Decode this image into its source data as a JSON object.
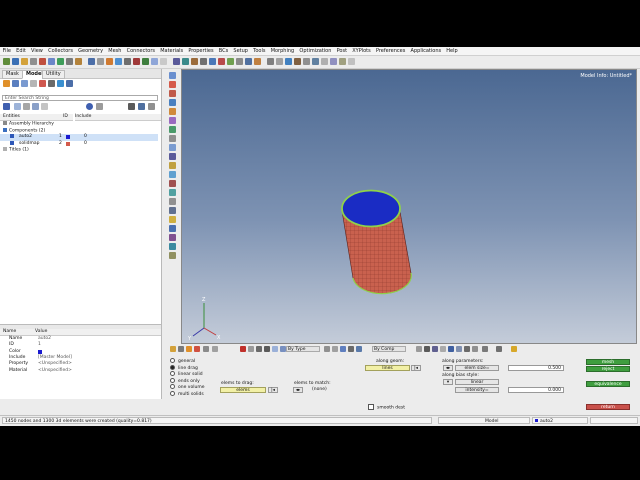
{
  "menu": [
    "File",
    "Edit",
    "View",
    "Collectors",
    "Geometry",
    "Mesh",
    "Connectors",
    "Materials",
    "Properties",
    "BCs",
    "Setup",
    "Tools",
    "Morphing",
    "Optimization",
    "Post",
    "XYPlots",
    "Preferences",
    "Applications",
    "Help"
  ],
  "left_panel": {
    "tabs": [
      "Mask",
      "Model",
      "Utility"
    ],
    "search_placeholder": "Enter Search String",
    "tree_headers": {
      "entities": "Entities",
      "id": "ID",
      "include": "Include"
    },
    "tree": [
      {
        "label": "Assembly Hierarchy",
        "id": "",
        "include": ""
      },
      {
        "label": "Components (2)",
        "id": "",
        "include": ""
      },
      {
        "label": "auto2",
        "id": "1",
        "include": "0",
        "color": "#1a1ad0",
        "selected": true
      },
      {
        "label": "solidmap",
        "id": "2",
        "include": "0",
        "color": "#d45a4a",
        "selected": false
      },
      {
        "label": "Titles (1)",
        "id": "",
        "include": ""
      }
    ],
    "prop_headers": {
      "name": "Name",
      "value": "Value"
    },
    "props": [
      {
        "name": "Name",
        "value": "auto2"
      },
      {
        "name": "ID",
        "value": "1"
      },
      {
        "name": "Color",
        "value": "",
        "swatch": "#1a1ad0"
      },
      {
        "name": "Include",
        "value": "[Master Model]"
      },
      {
        "name": "Property",
        "value": "<Unspecified>"
      },
      {
        "name": "Material",
        "value": "<Unspecified>"
      }
    ]
  },
  "viewport": {
    "model_info": "Model Info: Untitled*",
    "axis_labels": {
      "x": "X",
      "y": "Y",
      "z": "Z"
    }
  },
  "bottom_panel": {
    "dropdown_by_type": "By Type",
    "dropdown_by_comp": "By Comp",
    "options": [
      {
        "label": "general",
        "on": false
      },
      {
        "label": "line drag",
        "on": true
      },
      {
        "label": "linear solid",
        "on": false
      },
      {
        "label": "ends only",
        "on": false
      },
      {
        "label": "one volume",
        "on": false
      },
      {
        "label": "multi solids",
        "on": false
      }
    ],
    "along_geom_label": "along geom:",
    "lines_button": "lines",
    "elems_to_drag_label": "elems to drag:",
    "elems_button": "elems",
    "elems_to_match_label": "elems to match:",
    "none_value": "(none)",
    "along_params_label": "along parameters:",
    "elem_size_label": "elem size=",
    "elem_size_value": "0.500",
    "along_bias_label": "along bias style:",
    "linear_label": "linear",
    "intensity_label": "intensity=",
    "intensity_value": "0.000",
    "smooth_dest_label": "smooth dest",
    "mesh_button": "mesh",
    "reject_button": "reject",
    "equivalence_button": "equivalence",
    "return_button": "return"
  },
  "status_bar": {
    "message": "1450 nodes and 1300 3d elements were created (quality=0.817)",
    "model": "Model",
    "component": "auto2"
  },
  "colors": {
    "cap": "#1a2cc4",
    "wall": "#c9614e",
    "edge": "#8fd24a",
    "viewport_top": "#4b6892",
    "viewport_bottom": "#c4ccd9"
  }
}
